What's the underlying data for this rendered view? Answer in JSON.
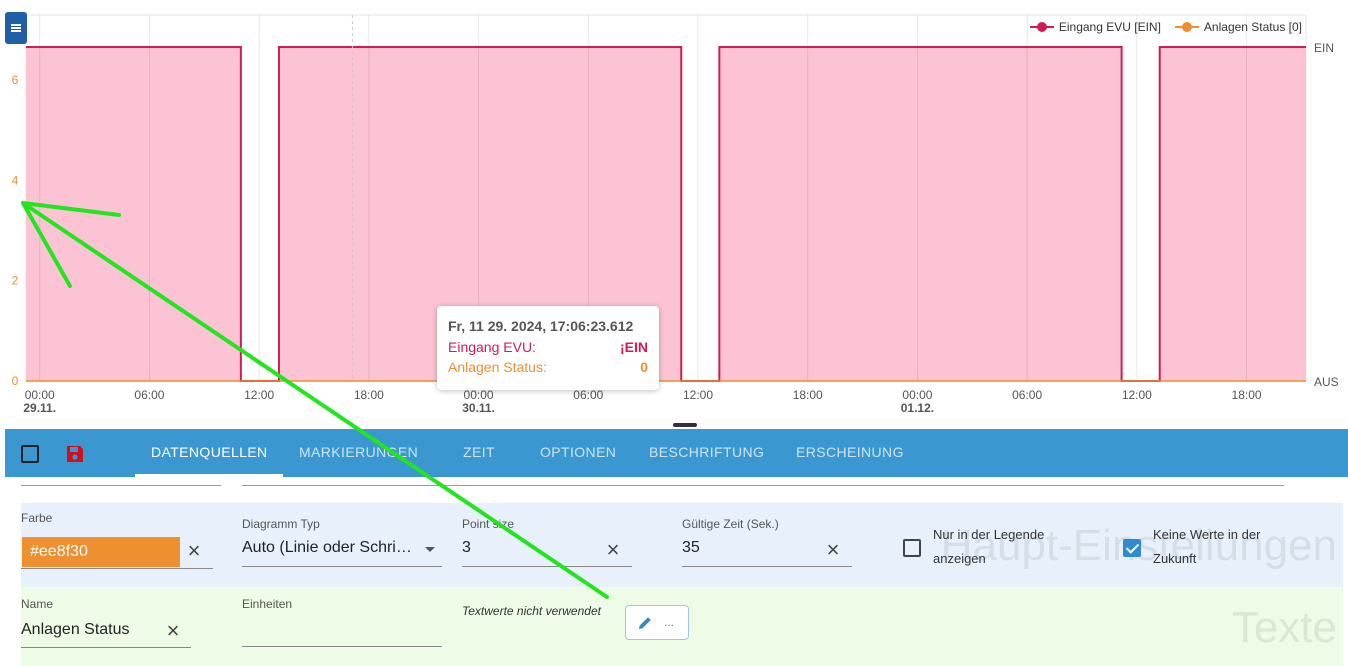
{
  "chart": {
    "legend": [
      {
        "label": "Eingang EVU [EIN]",
        "color": "#d21b55"
      },
      {
        "label": "Anlagen Status [0]",
        "color": "#ee8f30"
      }
    ],
    "y_left_ticks": [
      "0",
      "2",
      "4",
      "6"
    ],
    "y_right_top": "EIN",
    "y_right_bottom": "AUS",
    "x_ticks": [
      "00:00",
      "06:00",
      "12:00",
      "18:00",
      "00:00",
      "06:00",
      "12:00",
      "18:00",
      "00:00",
      "06:00",
      "12:00",
      "18:00"
    ],
    "x_dates": [
      "29.11.",
      "30.11.",
      "01.12."
    ],
    "tooltip": {
      "title": "Fr, 11 29. 2024, 17:06:23.612",
      "row1_label": "Eingang EVU:",
      "row1_value": "¡EIN",
      "row2_label": "Anlagen Status:",
      "row2_value": "0"
    }
  },
  "chart_data": {
    "type": "area",
    "title": "",
    "xlabel": "",
    "ylabel": "",
    "ylim": [
      0,
      7.3
    ],
    "step": true,
    "grid": true,
    "legend_position": "top-right",
    "x_ticks": [
      "00:00",
      "06:00",
      "12:00",
      "18:00",
      "00:00",
      "06:00",
      "12:00",
      "18:00",
      "00:00",
      "06:00",
      "12:00",
      "18:00"
    ],
    "x_dates": [
      "29.11.",
      "30.11.",
      "01.12."
    ],
    "series": [
      {
        "name": "Eingang EVU [EIN]",
        "color": "#d21b55",
        "axis": "right",
        "axis_labels": [
          "AUS",
          "EIN"
        ],
        "x": [
          "28.11. 23:15",
          "29.11. 11:00",
          "29.11. 13:05",
          "30.11. 11:05",
          "30.11. 13:10",
          "01.12. 11:10",
          "01.12. 13:15",
          "01.12. 21:15"
        ],
        "values": [
          "EIN",
          "AUS",
          "EIN",
          "AUS",
          "EIN",
          "AUS",
          "EIN",
          "EIN"
        ]
      },
      {
        "name": "Anlagen Status [0]",
        "color": "#ee8f30",
        "axis": "left",
        "x": [
          "28.11. 23:15",
          "01.12. 21:15"
        ],
        "values": [
          0,
          0
        ]
      }
    ]
  },
  "toolbar": {
    "tabs": [
      "DATENQUELLEN",
      "MARKIERUNGEN",
      "ZEIT",
      "OPTIONEN",
      "BESCHRIFTUNG",
      "ERSCHEINUNG"
    ],
    "active_tab": "DATENQUELLEN"
  },
  "main_settings": {
    "watermark": "Haupt-Einstellungen",
    "color_label": "Farbe",
    "color_value": "#ee8f30",
    "chart_type_label": "Diagramm Typ",
    "chart_type_value": "Auto (Linie oder Schri…",
    "point_size_label": "Point size",
    "point_size_value": "3",
    "valid_time_label": "Gültige Zeit (Sek.)",
    "valid_time_value": "35",
    "legend_only_label_1": "Nur in der Legende",
    "legend_only_label_2": "anzeigen",
    "no_future_label_1": "Keine Werte in der",
    "no_future_label_2": "Zukunft"
  },
  "texts_section": {
    "watermark": "Texte",
    "name_label": "Name",
    "name_value": "Anlagen Status",
    "units_label": "Einheiten",
    "units_value": "",
    "text_values_note": "Textwerte nicht verwendet",
    "edit_button_label": "..."
  },
  "colors": {
    "accent": "#3a97d0",
    "evu_line": "#d21b55",
    "area_fill": "#fbc3d3",
    "status": "#ee8f30",
    "annotation_arrow": "#22e51f"
  }
}
